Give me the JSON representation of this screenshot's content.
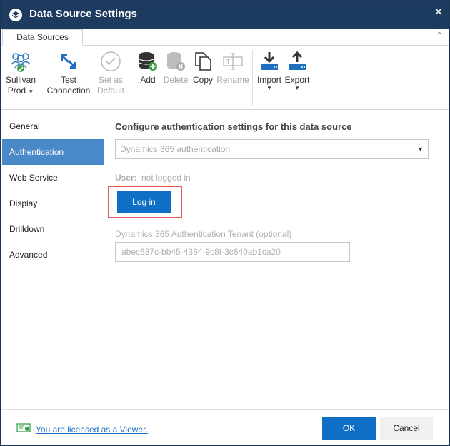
{
  "window": {
    "title": "Data Source Settings",
    "close_glyph": "✕"
  },
  "tabs": [
    {
      "label": "Data Sources"
    }
  ],
  "ribbon": {
    "source": {
      "line1": "Sullivan",
      "line2": "Prod"
    },
    "test": {
      "line1": "Test",
      "line2": "Connection"
    },
    "setdefault": {
      "line1": "Set as",
      "line2": "Default"
    },
    "add": "Add",
    "delete": "Delete",
    "copy": "Copy",
    "rename": "Rename",
    "import": "Import",
    "export": "Export"
  },
  "sidebar": {
    "items": [
      {
        "label": "General"
      },
      {
        "label": "Authentication"
      },
      {
        "label": "Web Service"
      },
      {
        "label": "Display"
      },
      {
        "label": "Drilldown"
      },
      {
        "label": "Advanced"
      }
    ],
    "active_index": 1
  },
  "main": {
    "heading": "Configure authentication settings for this data source",
    "auth_select": "Dynamics 365 authentication",
    "user_label": "User:",
    "user_value": "not logged in",
    "login_button": "Log in",
    "tenant_label": "Dynamics 365 Authentication Tenant (optional)",
    "tenant_value": "abec637c-bb45-4364-9c8f-3c640ab1ca20"
  },
  "footer": {
    "license_text": "You are licensed as a Viewer.",
    "ok_label": "OK",
    "cancel_label": "Cancel"
  },
  "colors": {
    "titlebar": "#1d3a5f",
    "accent": "#0f6fc6",
    "sidebar_active": "#4a89c8",
    "highlight": "#e05a5a"
  }
}
